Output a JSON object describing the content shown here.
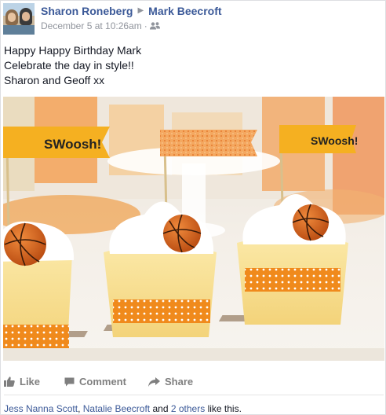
{
  "post": {
    "author": "Sharon Roneberg",
    "target": "Mark Beecroft",
    "timestamp": "December 5 at 10:26am",
    "separator": "·",
    "audience_icon": "friends-icon",
    "text_lines": [
      "Happy Happy Birthday Mark",
      "Celebrate the day in style!!",
      "Sharon and Geoff xx"
    ]
  },
  "photo": {
    "flags": [
      "SWoosh!",
      "SWoosh!"
    ]
  },
  "actions": {
    "like": "Like",
    "comment": "Comment",
    "share": "Share"
  },
  "likes": {
    "name1": "Jess Nanna Scott",
    "comma": ",",
    "name2": "Natalie Beecroft",
    "and": "and",
    "others": "2 others",
    "suffix": "like this."
  },
  "colors": {
    "link": "#3b5998",
    "meta": "#90949c",
    "action": "#7f7f7f"
  }
}
